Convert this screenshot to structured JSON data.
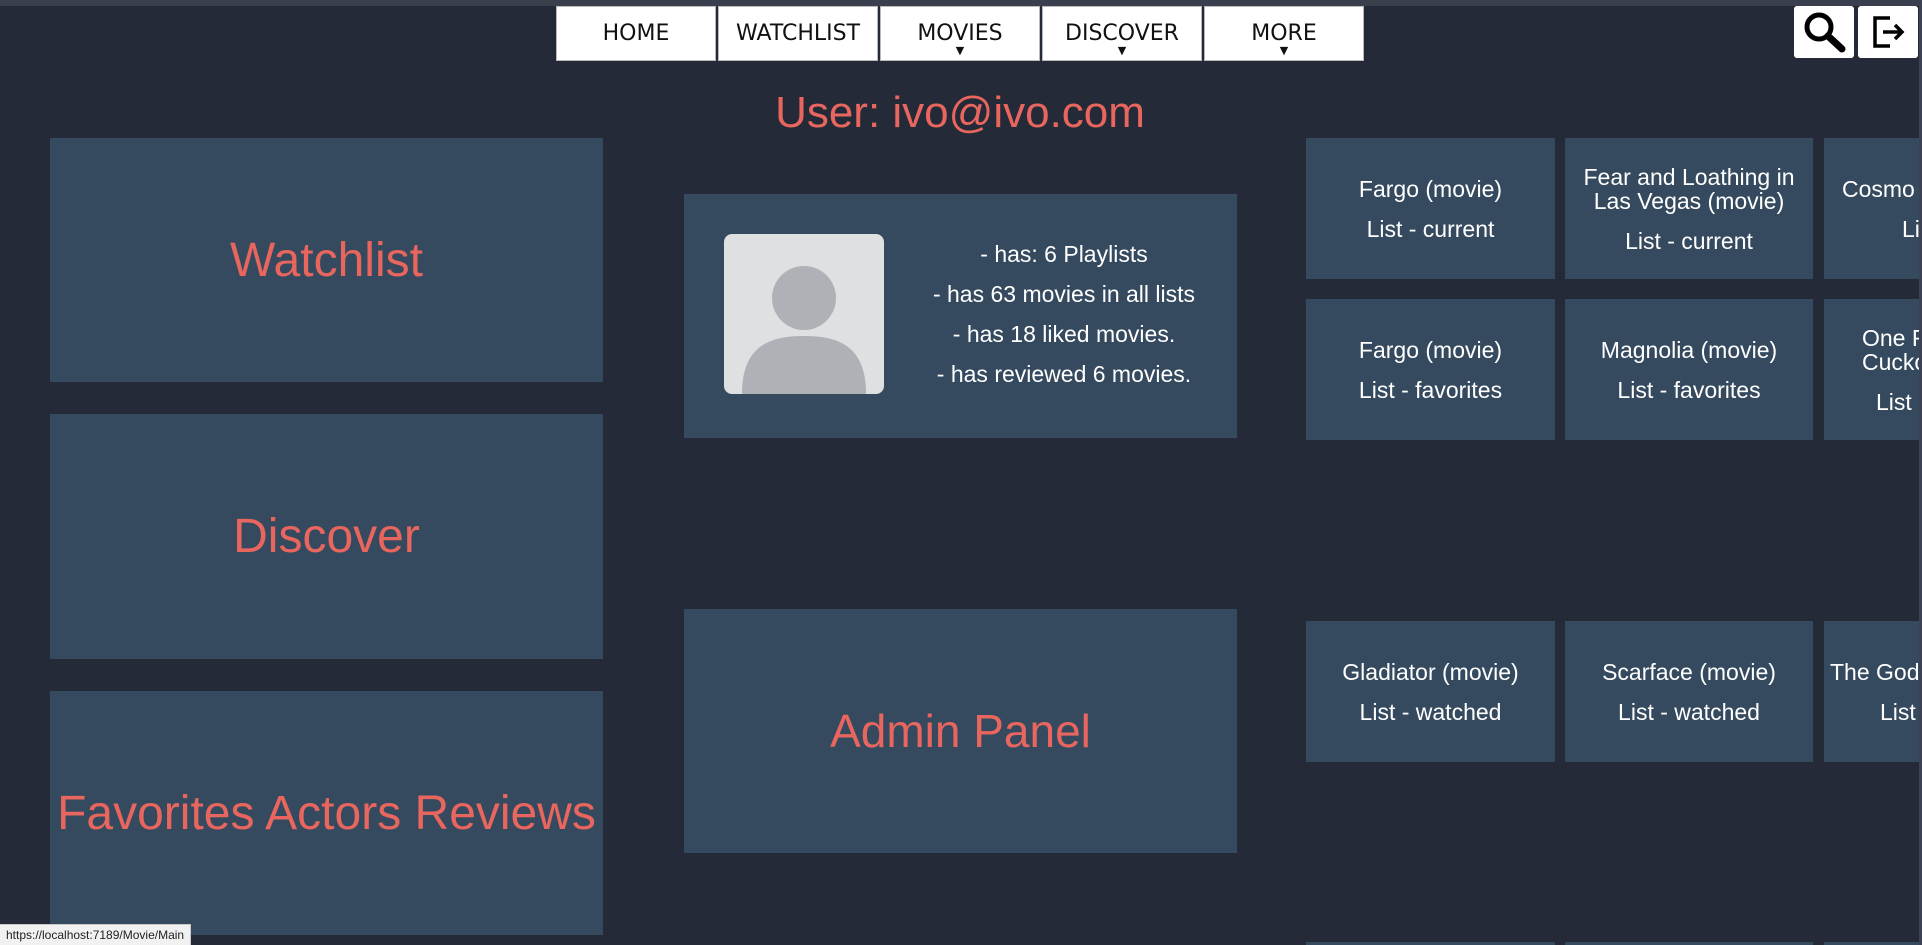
{
  "nav": {
    "items": [
      {
        "label": "HOME",
        "dropdown": false
      },
      {
        "label": "WATCHLIST",
        "dropdown": false
      },
      {
        "label": "MOVIES",
        "dropdown": true
      },
      {
        "label": "DISCOVER",
        "dropdown": true
      },
      {
        "label": "MORE",
        "dropdown": true
      }
    ],
    "dropdown_glyph": "▼",
    "search_icon": "search-icon",
    "logout_icon": "logout-icon"
  },
  "user": {
    "title": "User: ivo@ivo.com",
    "stats": [
      "- has: 6 Playlists",
      "- has 63 movies in all lists",
      "- has 18 liked movies.",
      "- has reviewed 6 movies."
    ]
  },
  "tiles": {
    "watchlist": "Watchlist",
    "discover": "Discover",
    "favorites": "Favorites Actors Reviews",
    "admin": "Admin Panel"
  },
  "movies": {
    "current": [
      {
        "title": "Fargo (movie)",
        "list": "List - current"
      },
      {
        "title": "Fear and Loathing in Las Vegas (movie)",
        "list": "List - current"
      },
      {
        "title": "Cosmo",
        "list": "List"
      }
    ],
    "favorites": [
      {
        "title": "Fargo (movie)",
        "list": "List - favorites"
      },
      {
        "title": "Magnolia (movie)",
        "list": "List - favorites"
      },
      {
        "title": "One Fl Cuckoo's",
        "list": "List -"
      }
    ],
    "watched": [
      {
        "title": "Gladiator (movie)",
        "list": "List - watched"
      },
      {
        "title": "Scarface (movie)",
        "list": "List - watched"
      },
      {
        "title": "The God",
        "list": "List -"
      }
    ]
  },
  "status_bar": {
    "url": "https://localhost:7189/Movie/Main"
  },
  "colors": {
    "background": "#252a38",
    "tile": "#354a5e",
    "accent": "#e8665e",
    "text": "#ffffff"
  }
}
